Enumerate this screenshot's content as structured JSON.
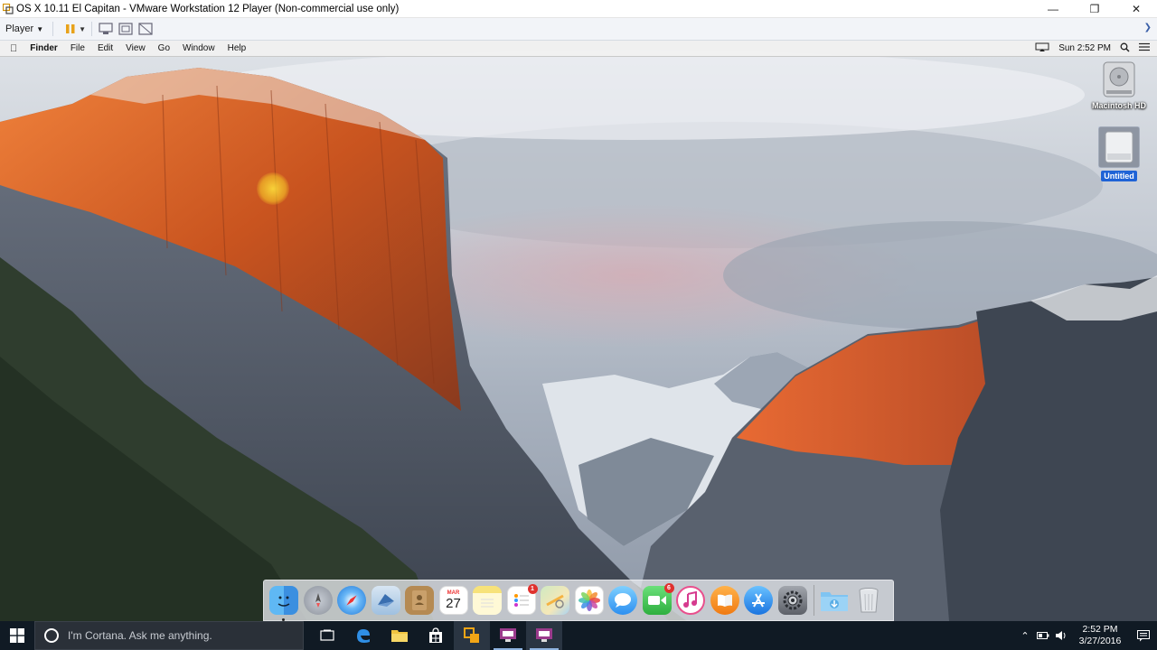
{
  "window": {
    "title": "OS X 10.11 El Capitan - VMware Workstation 12 Player (Non-commercial use only)",
    "controls": [
      "minimize",
      "maximize",
      "close"
    ]
  },
  "vm_toolbar": {
    "player_menu": "Player",
    "buttons": [
      "pause-icon",
      "send-ctrl-alt-del-icon",
      "fullscreen-icon",
      "unity-icon"
    ]
  },
  "mac_menubar": {
    "app": "Finder",
    "menus": [
      "File",
      "Edit",
      "View",
      "Go",
      "Window",
      "Help"
    ],
    "clock": "Sun 2:52 PM"
  },
  "desktop_icons": [
    {
      "label": "Macintosh HD",
      "icon": "hard-drive-icon"
    },
    {
      "label": "Untitled",
      "icon": "disk-icon",
      "selected": true
    }
  ],
  "dock": {
    "items": [
      {
        "name": "Finder",
        "icon": "finder-icon"
      },
      {
        "name": "Launchpad",
        "icon": "launchpad-icon"
      },
      {
        "name": "Safari",
        "icon": "safari-icon"
      },
      {
        "name": "Mail",
        "icon": "mail-icon"
      },
      {
        "name": "Contacts",
        "icon": "contacts-icon"
      },
      {
        "name": "Calendar",
        "icon": "calendar-icon",
        "month": "MAR",
        "day": "27"
      },
      {
        "name": "Notes",
        "icon": "notes-icon"
      },
      {
        "name": "Reminders",
        "icon": "reminders-icon",
        "badge": "1"
      },
      {
        "name": "Maps",
        "icon": "maps-icon"
      },
      {
        "name": "Photos",
        "icon": "photos-icon"
      },
      {
        "name": "Messages",
        "icon": "messages-icon"
      },
      {
        "name": "FaceTime",
        "icon": "facetime-icon",
        "badge": "6"
      },
      {
        "name": "iTunes",
        "icon": "itunes-icon"
      },
      {
        "name": "iBooks",
        "icon": "ibooks-icon"
      },
      {
        "name": "App Store",
        "icon": "app-store-icon"
      },
      {
        "name": "System Preferences",
        "icon": "system-preferences-icon"
      },
      {
        "name": "Downloads",
        "icon": "downloads-folder-icon"
      },
      {
        "name": "Trash",
        "icon": "trash-icon"
      }
    ]
  },
  "taskbar": {
    "cortana_placeholder": "I'm Cortana. Ask me anything.",
    "time": "2:52 PM",
    "date": "3/27/2016"
  },
  "colors": {
    "taskbar": "#101a24",
    "selection": "#1f63d6",
    "dock_badge": "#e0312e"
  }
}
